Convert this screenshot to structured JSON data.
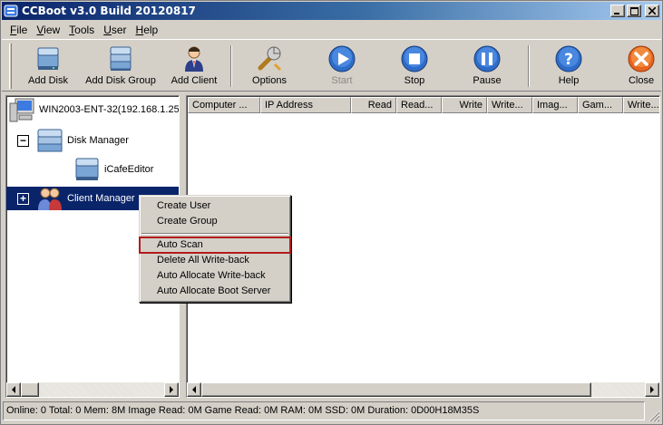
{
  "window": {
    "title": "CCBoot v3.0 Build 20120817"
  },
  "menubar": {
    "items": [
      {
        "label_ul": "F",
        "label_rest": "ile"
      },
      {
        "label_ul": "V",
        "label_rest": "iew"
      },
      {
        "label_ul": "T",
        "label_rest": "ools"
      },
      {
        "label_ul": "U",
        "label_rest": "ser"
      },
      {
        "label_ul": "H",
        "label_rest": "elp"
      }
    ]
  },
  "toolbar": {
    "add_disk": "Add Disk",
    "add_disk_group": "Add Disk Group",
    "add_client": "Add Client",
    "options": "Options",
    "start": "Start",
    "stop": "Stop",
    "pause": "Pause",
    "help": "Help",
    "close": "Close"
  },
  "tree": {
    "server": "WIN2003-ENT-32(192.168.1.25",
    "disk_manager": "Disk Manager",
    "disk_manager_expander": "−",
    "icafe_editor": "iCafeEditor",
    "client_manager": "Client Manager",
    "client_manager_expander": "+"
  },
  "list": {
    "columns": [
      "Computer ...",
      "IP Address",
      "Read",
      "Read...",
      "Write",
      "Write...",
      "Imag...",
      "Gam...",
      "Write..."
    ]
  },
  "context_menu": {
    "items": [
      "Create User",
      "Create Group",
      "Auto Scan",
      "Delete All Write-back",
      "Auto Allocate Write-back",
      "Auto Allocate Boot Server"
    ]
  },
  "status": {
    "text": "Online: 0 Total: 0 Mem: 8M Image Read: 0M Game Read: 0M RAM: 0M SSD: 0M Duration: 0D00H18M35S"
  },
  "colors": {
    "title_start": "#0a246a",
    "title_end": "#a6caf0",
    "selection": "#0a246a",
    "highlight_box": "#b31b1b"
  }
}
